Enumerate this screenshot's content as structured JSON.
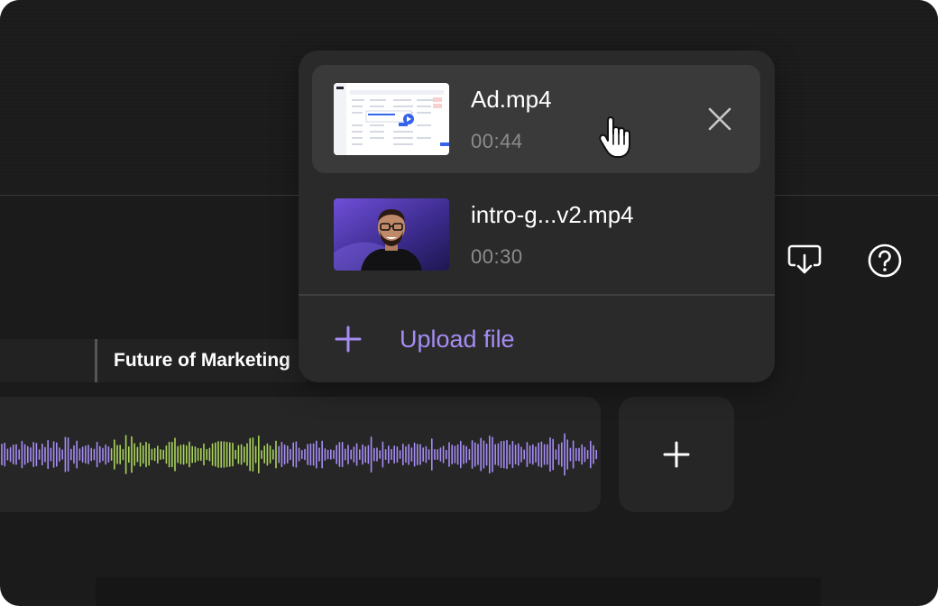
{
  "timeline": {
    "track_label": "Future of Marketing"
  },
  "media_menu": {
    "items": [
      {
        "name": "Ad.mp4",
        "duration": "00:44",
        "thumbnail": "screen-recording-table",
        "selected": true
      },
      {
        "name": "intro-g...v2.mp4",
        "duration": "00:30",
        "thumbnail": "presenter-portrait",
        "selected": false
      }
    ],
    "upload_label": "Upload file",
    "remove_icon": "close-icon"
  },
  "toolbar": {
    "icons": [
      "export-download-icon",
      "help-icon"
    ]
  },
  "colors": {
    "waveform_primary": "#a68cf5",
    "waveform_highlight": "#a8d35a",
    "upload_accent": "#a68cf5",
    "background": "#1b1b1b",
    "panel": "#2a2a2a"
  }
}
